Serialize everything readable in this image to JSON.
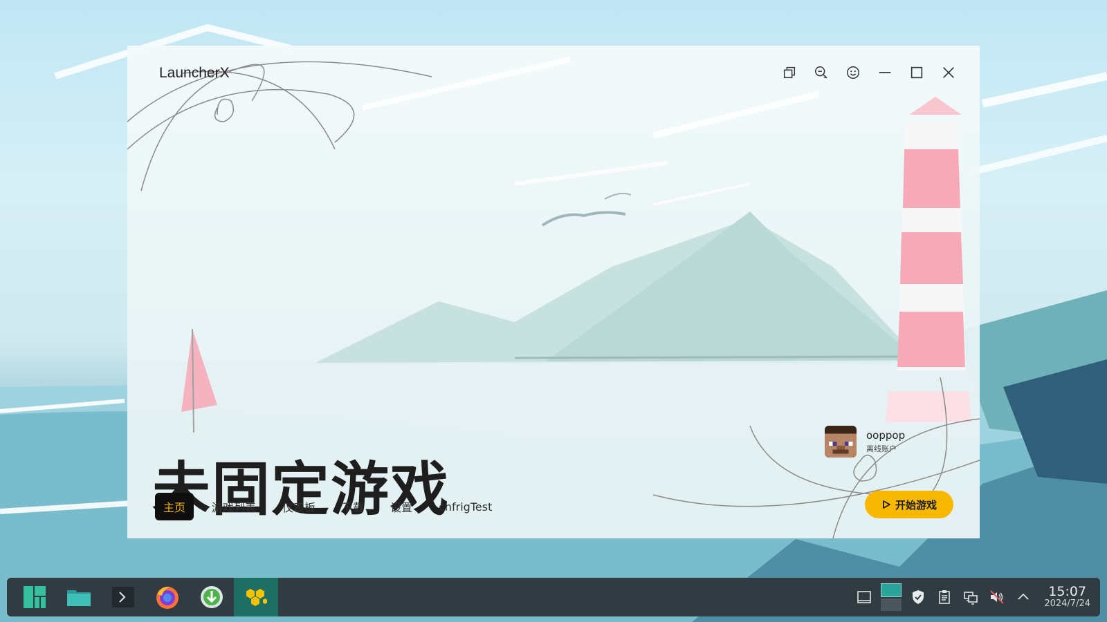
{
  "window": {
    "app_title": "LauncherX",
    "hero_title": "未固定游戏"
  },
  "nav": {
    "items": [
      {
        "label": "主页",
        "active": true
      },
      {
        "label": "游戏列表",
        "active": false
      },
      {
        "label": "仪表板",
        "active": false
      },
      {
        "label": "下载",
        "active": false
      },
      {
        "label": "设置",
        "active": false
      },
      {
        "label": "chfrigTest",
        "active": false
      }
    ]
  },
  "account": {
    "name": "ooppop",
    "type": "离线账户"
  },
  "play_button": {
    "label": "开始游戏",
    "color": "#f9b800"
  },
  "titlebar": {
    "icons": [
      "window-switch-icon",
      "feedback-icon",
      "emoji-icon",
      "minimize-icon",
      "maximize-icon",
      "close-icon"
    ]
  },
  "taskbar": {
    "apps": [
      "manjaro-menu-icon",
      "file-manager-icon",
      "terminal-icon",
      "firefox-icon",
      "download-manager-icon",
      "launcherx-icon"
    ],
    "tray": [
      "show-desktop-icon",
      "virtual-desktop-icon",
      "shield-icon",
      "clipboard-icon",
      "network-icon",
      "volume-muted-icon",
      "tray-expand-icon"
    ],
    "clock_time": "15:07",
    "clock_date": "2024/7/24"
  },
  "colors": {
    "accent": "#f9b800",
    "taskbar": "#313b42",
    "active_task": "#1f6e64"
  }
}
